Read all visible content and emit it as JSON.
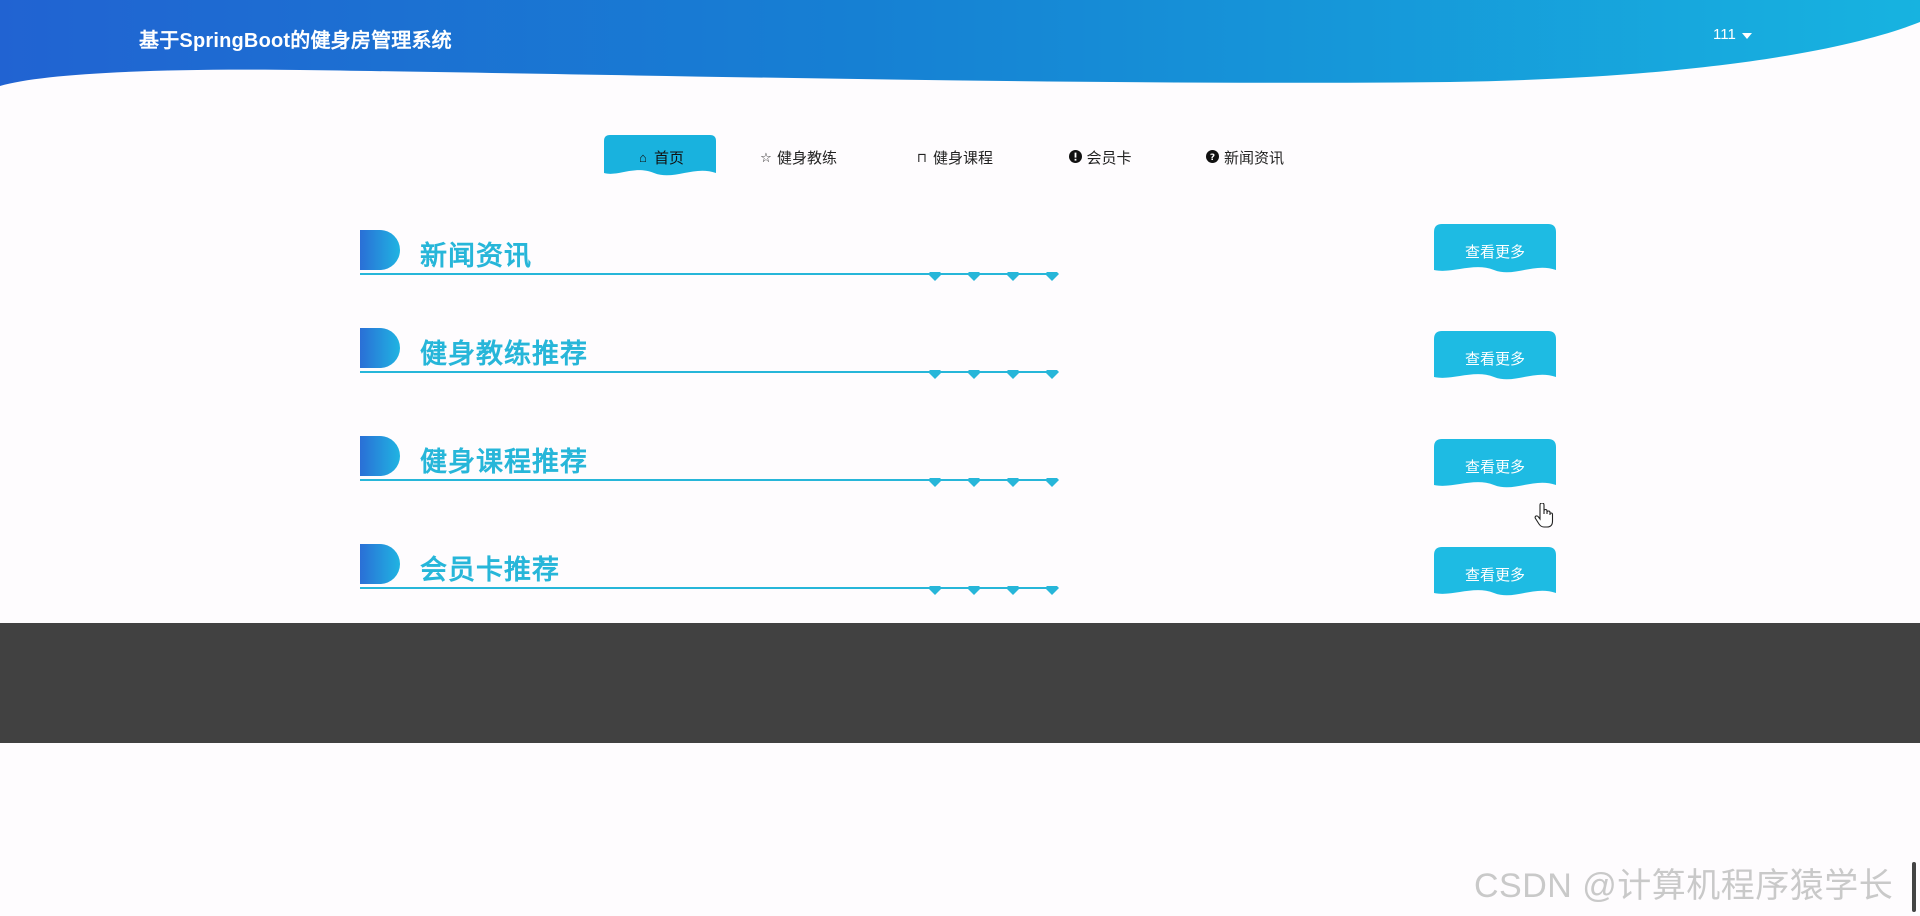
{
  "header": {
    "title": "基于SpringBoot的健身房管理系统",
    "user": "111"
  },
  "nav": {
    "items": [
      {
        "label": "首页",
        "icon": "home-icon",
        "glyph": "⌂",
        "active": true
      },
      {
        "label": "健身教练",
        "icon": "star-icon",
        "glyph": "☆",
        "active": false
      },
      {
        "label": "健身课程",
        "icon": "bag-icon",
        "glyph": "⊓",
        "active": false
      },
      {
        "label": "会员卡",
        "icon": "exclamation-circle-icon",
        "glyph": "!",
        "active": false
      },
      {
        "label": "新闻资讯",
        "icon": "question-circle-icon",
        "glyph": "?",
        "active": false
      }
    ]
  },
  "sections": [
    {
      "title": "新闻资讯",
      "more_label": "查看更多"
    },
    {
      "title": "健身教练推荐",
      "more_label": "查看更多"
    },
    {
      "title": "健身课程推荐",
      "more_label": "查看更多"
    },
    {
      "title": "会员卡推荐",
      "more_label": "查看更多"
    }
  ],
  "watermark": "CSDN @计算机程序猿学长",
  "colors": {
    "header_start": "#1f63d3",
    "header_end": "#1ab0e0",
    "accent": "#27b6d9",
    "footer": "#414141"
  }
}
